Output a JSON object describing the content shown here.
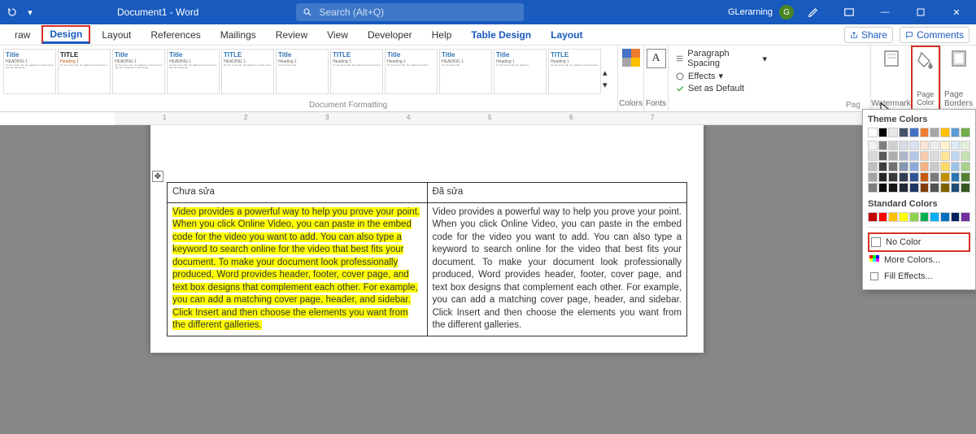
{
  "title_bar": {
    "document": "Document1 - Word",
    "search_placeholder": "Search (Alt+Q)",
    "user": "GLerarning",
    "avatar": "G"
  },
  "tabs": [
    "raw",
    "Design",
    "Layout",
    "References",
    "Mailings",
    "Review",
    "View",
    "Developer",
    "Help",
    "Table Design",
    "Layout"
  ],
  "share": "Share",
  "comments": "Comments",
  "ribbon": {
    "colors": "Colors",
    "fonts": "Fonts",
    "paragraph_spacing": "Paragraph Spacing",
    "effects": "Effects",
    "set_default": "Set as Default",
    "watermark": "Watermark",
    "page_color": "Page Color",
    "page_borders": "Page Borders",
    "doc_formatting": "Document Formatting",
    "page_bg": "Pag"
  },
  "style_labels": {
    "title": "Title",
    "title_caps": "TITLE",
    "heading": "HEADING 1",
    "heading_mixed": "Heading 1"
  },
  "popup": {
    "theme": "Theme Colors",
    "standard": "Standard Colors",
    "no_color": "No Color",
    "more": "More Colors...",
    "fill": "Fill Effects..."
  },
  "table": {
    "h1": "Chưa sửa",
    "h2": "Đã sửa",
    "c1": "Video provides a powerful way to help you prove your point. When you click Online Video, you can paste in the embed code for the video you want to add. You can also type a keyword to search online for the video that best fits your document. To make your document look professionally produced, Word provides header, footer, cover page, and text box designs that complement each other. For example, you can add a matching cover page, header, and sidebar. Click Insert and then choose the elements you want from the different galleries.",
    "c2": "Video provides a powerful way to help you prove your point. When you click Online Video, you can paste in the embed code for the video you want to add. You can also type a keyword to search online for the video that best fits your document. To make your document look professionally produced, Word provides header, footer, cover page, and text box designs that complement each other. For example, you can add a matching cover page, header, and sidebar. Click Insert and then choose the elements you want from the different galleries."
  },
  "ruler": [
    "1",
    "2",
    "3",
    "4",
    "5",
    "6",
    "7"
  ],
  "theme_colors_row1": [
    "#ffffff",
    "#000000",
    "#E7E6E6",
    "#44546A",
    "#4472C4",
    "#ED7D31",
    "#A5A5A5",
    "#FFC000",
    "#5B9BD5",
    "#70AD47"
  ],
  "theme_tints": [
    [
      "#F2F2F2",
      "#7F7F7F",
      "#D0CECE",
      "#D6DCE4",
      "#D9E2F3",
      "#FBE5D5",
      "#EDEDED",
      "#FFF2CC",
      "#DEEBF6",
      "#E2EFD9"
    ],
    [
      "#D8D8D8",
      "#595959",
      "#AEABAB",
      "#ADB9CA",
      "#B4C6E7",
      "#F7CBAC",
      "#DBDBDB",
      "#FEE599",
      "#BDD7EE",
      "#C5E0B3"
    ],
    [
      "#BFBFBF",
      "#3F3F3F",
      "#757070",
      "#8496B0",
      "#8EAADB",
      "#F4B183",
      "#C9C9C9",
      "#FFD965",
      "#9CC3E5",
      "#A8D08D"
    ],
    [
      "#A5A5A5",
      "#262626",
      "#3A3838",
      "#323F4F",
      "#2F5496",
      "#C55A11",
      "#7B7B7B",
      "#BF9000",
      "#2E75B5",
      "#538135"
    ],
    [
      "#7F7F7F",
      "#0C0C0C",
      "#171616",
      "#222A35",
      "#1F3864",
      "#833C0B",
      "#525252",
      "#7F6000",
      "#1E4E79",
      "#375623"
    ]
  ],
  "standard_colors": [
    "#C00000",
    "#FF0000",
    "#FFC000",
    "#FFFF00",
    "#92D050",
    "#00B050",
    "#00B0F0",
    "#0070C0",
    "#002060",
    "#7030A0"
  ]
}
